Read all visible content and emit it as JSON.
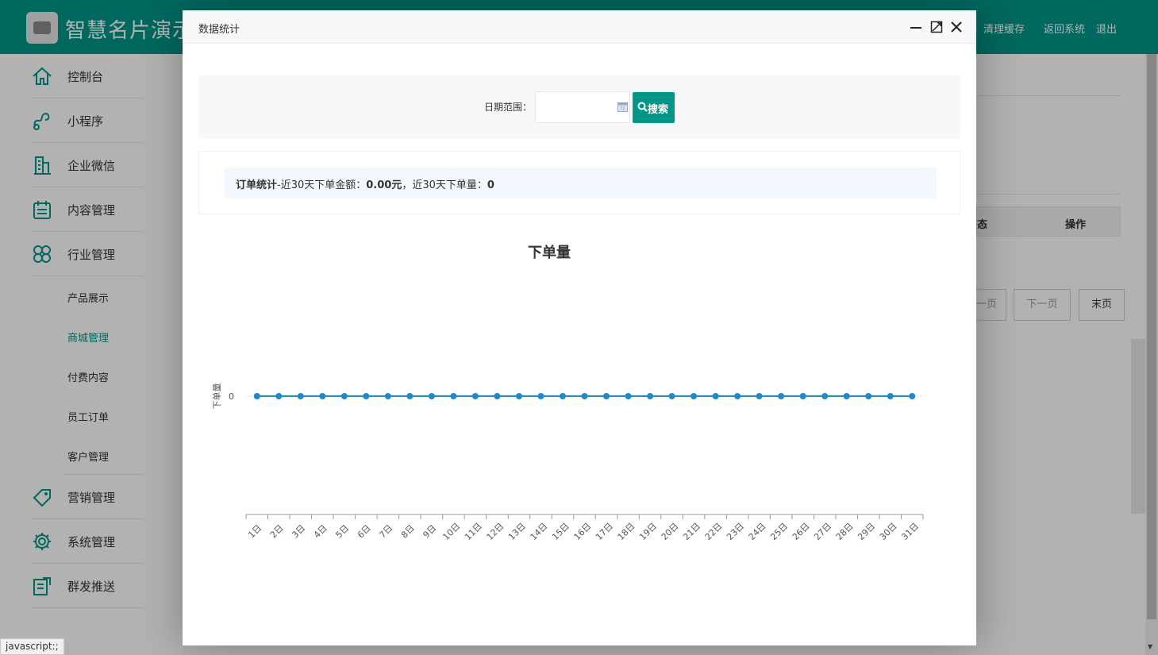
{
  "app": {
    "title": "智慧名片演示",
    "top_links": [
      "清理缓存",
      "返回系统",
      "退出"
    ]
  },
  "sidebar": {
    "items": [
      {
        "label": "控制台",
        "icon": "home-icon"
      },
      {
        "label": "小程序",
        "icon": "miniprogram-icon"
      },
      {
        "label": "企业微信",
        "icon": "building-icon"
      },
      {
        "label": "内容管理",
        "icon": "calendar-icon"
      },
      {
        "label": "行业管理",
        "icon": "clover-icon"
      }
    ],
    "sub_items": [
      "产品展示",
      "商城管理",
      "付费内容",
      "员工订单",
      "客户管理"
    ],
    "active_sub_item": "商城管理",
    "bottom_items": [
      {
        "label": "营销管理",
        "icon": "tag-icon"
      },
      {
        "label": "系统管理",
        "icon": "gear-icon"
      },
      {
        "label": "群发推送",
        "icon": "edit-icon"
      }
    ]
  },
  "background": {
    "table_headers": [
      "态",
      "操作"
    ],
    "pagination": [
      "一页",
      "下一页",
      "末页"
    ]
  },
  "modal": {
    "title": "数据统计",
    "controls": [
      "minimize-icon",
      "maximize-icon",
      "close-icon"
    ],
    "search": {
      "label": "日期范围：",
      "date_value": "",
      "button_label": "搜索"
    },
    "stats": {
      "title": "订单统计",
      "text1": "-近30天下单金额：",
      "amount": "0.00元",
      "text2": "，近30天下单量：",
      "count": "0"
    }
  },
  "chart_data": {
    "type": "line",
    "title": "下单量",
    "ylabel": "下单量",
    "categories": [
      "1日",
      "2日",
      "3日",
      "4日",
      "5日",
      "6日",
      "7日",
      "8日",
      "9日",
      "10日",
      "11日",
      "12日",
      "13日",
      "14日",
      "15日",
      "16日",
      "17日",
      "18日",
      "19日",
      "20日",
      "21日",
      "22日",
      "23日",
      "24日",
      "25日",
      "26日",
      "27日",
      "28日",
      "29日",
      "30日",
      "31日"
    ],
    "series": [
      {
        "values": [
          0,
          0,
          0,
          0,
          0,
          0,
          0,
          0,
          0,
          0,
          0,
          0,
          0,
          0,
          0,
          0,
          0,
          0,
          0,
          0,
          0,
          0,
          0,
          0,
          0,
          0,
          0,
          0,
          0,
          0,
          0
        ]
      }
    ],
    "y_ticks": [
      "0"
    ],
    "line_color": "#1e8ac9"
  },
  "status_bar": {
    "text": "javascript:;"
  }
}
